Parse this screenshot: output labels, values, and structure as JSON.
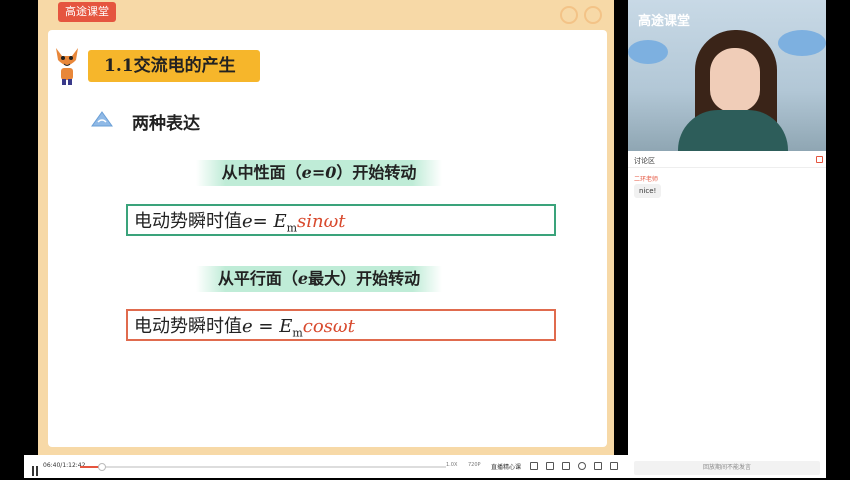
{
  "app": {
    "brand": "高途课堂",
    "video_logo": "高途课堂"
  },
  "slide": {
    "title": "1.1交流电的产生",
    "subtitle": "两种表达",
    "banner1": {
      "pre": "从中性面（",
      "var": "e=0",
      "post": "）开始转动"
    },
    "banner2": {
      "pre": "从平行面（",
      "var": "e",
      "post": "最大）开始转动"
    },
    "formula1": {
      "label": "电动势瞬时值",
      "var": "e",
      "eq": "= ",
      "em": "E",
      "em_sub": "m",
      "fn": "sinωt"
    },
    "formula2": {
      "label": "电动势瞬时值",
      "var": "e",
      "eq": " = ",
      "em": "E",
      "em_sub": "m",
      "fn": "cosωt"
    }
  },
  "player": {
    "time": "06:40/1:12:42",
    "progress": 0.06,
    "rate": "1.0X",
    "quality": "720P",
    "subtitle": "直播精心课"
  },
  "chat": {
    "header": "讨论区",
    "user": "二环老师",
    "message": "nice!",
    "input_placeholder": "回放期间不能发言"
  }
}
